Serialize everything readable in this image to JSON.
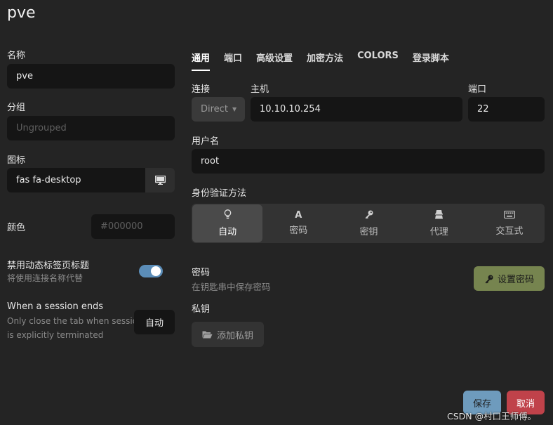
{
  "title": "pve",
  "left": {
    "name_label": "名称",
    "name_value": "pve",
    "group_label": "分组",
    "group_placeholder": "Ungrouped",
    "icon_label": "图标",
    "icon_value": "fas fa-desktop",
    "color_label": "颜色",
    "color_placeholder": "#000000",
    "dynamic_tab_title_label": "禁用动态标签页标题",
    "dynamic_tab_title_sub": "将使用连接名称代替",
    "dynamic_tab_title_enabled": true,
    "session_end_label": "When a session ends",
    "session_end_sub1": "Only close the tab when session",
    "session_end_sub2": "is explicitly terminated",
    "session_end_value": "自动"
  },
  "tabs": [
    "通用",
    "端口",
    "高级设置",
    "加密方法",
    "COLORS",
    "登录脚本"
  ],
  "active_tab": "通用",
  "connection": {
    "connect_label": "连接",
    "connect_value": "Direct",
    "host_label": "主机",
    "host_value": "10.10.10.254",
    "port_label": "端口",
    "port_value": "22"
  },
  "username": {
    "label": "用户名",
    "value": "root"
  },
  "auth": {
    "label": "身份验证方法",
    "options": [
      {
        "label": "自动",
        "icon": "lightbulb-icon",
        "glyph": "💡",
        "active": true
      },
      {
        "label": "密码",
        "icon": "font-icon",
        "glyph": "A",
        "active": false
      },
      {
        "label": "密钥",
        "icon": "key-icon",
        "glyph": "🔑",
        "active": false
      },
      {
        "label": "代理",
        "icon": "agent-icon",
        "glyph": "⛃",
        "active": false
      },
      {
        "label": "交互式",
        "icon": "keyboard-icon",
        "glyph": "⌨",
        "active": false
      }
    ]
  },
  "password": {
    "label": "密码",
    "sub": "在钥匙串中保存密码",
    "set_button": "设置密码"
  },
  "private_key": {
    "label": "私钥",
    "add_button": "添加私钥"
  },
  "footer": {
    "save": "保存",
    "cancel": "取消",
    "watermark": "CSDN @村口王师傅。"
  },
  "colors": {
    "save_bg": "#6e9bbd",
    "cancel_bg": "#c0424a",
    "set_password_bg": "#76844f",
    "toggle_on": "#5b8db8"
  }
}
